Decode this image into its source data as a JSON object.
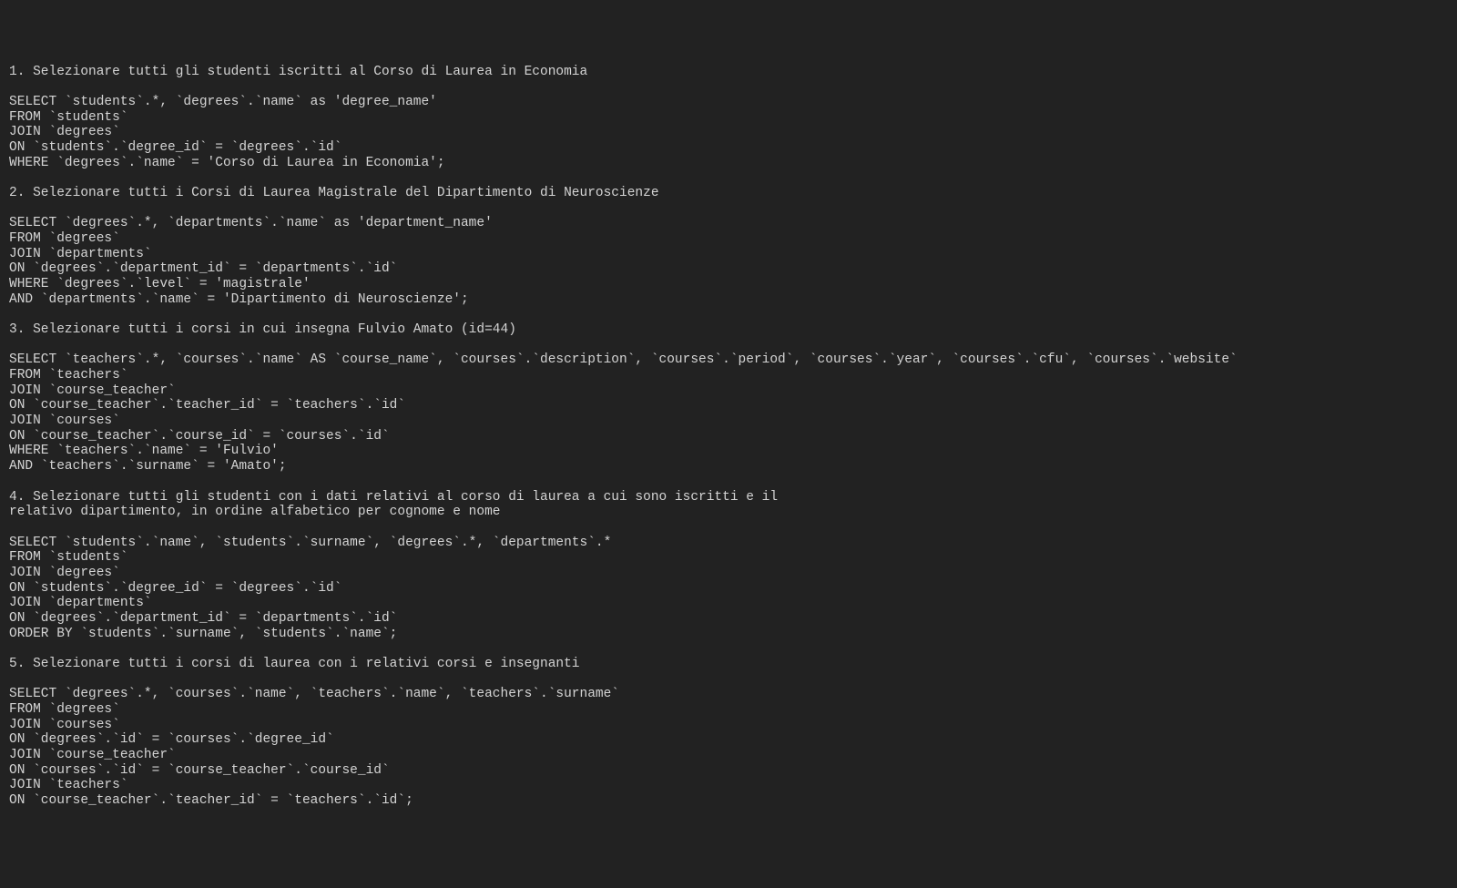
{
  "code": "1. Selezionare tutti gli studenti iscritti al Corso di Laurea in Economia\n\nSELECT `students`.*, `degrees`.`name` as 'degree_name'\nFROM `students`\nJOIN `degrees`\nON `students`.`degree_id` = `degrees`.`id`\nWHERE `degrees`.`name` = 'Corso di Laurea in Economia';\n\n2. Selezionare tutti i Corsi di Laurea Magistrale del Dipartimento di Neuroscienze\n\nSELECT `degrees`.*, `departments`.`name` as 'department_name'\nFROM `degrees`\nJOIN `departments`\nON `degrees`.`department_id` = `departments`.`id`\nWHERE `degrees`.`level` = 'magistrale'\nAND `departments`.`name` = 'Dipartimento di Neuroscienze';\n\n3. Selezionare tutti i corsi in cui insegna Fulvio Amato (id=44)\n\nSELECT `teachers`.*, `courses`.`name` AS `course_name`, `courses`.`description`, `courses`.`period`, `courses`.`year`, `courses`.`cfu`, `courses`.`website`\nFROM `teachers`\nJOIN `course_teacher`\nON `course_teacher`.`teacher_id` = `teachers`.`id`\nJOIN `courses`\nON `course_teacher`.`course_id` = `courses`.`id`\nWHERE `teachers`.`name` = 'Fulvio'\nAND `teachers`.`surname` = 'Amato';\n\n4. Selezionare tutti gli studenti con i dati relativi al corso di laurea a cui sono iscritti e il\nrelativo dipartimento, in ordine alfabetico per cognome e nome\n\nSELECT `students`.`name`, `students`.`surname`, `degrees`.*, `departments`.*\nFROM `students`\nJOIN `degrees`\nON `students`.`degree_id` = `degrees`.`id`\nJOIN `departments`\nON `degrees`.`department_id` = `departments`.`id`\nORDER BY `students`.`surname`, `students`.`name`;\n\n5. Selezionare tutti i corsi di laurea con i relativi corsi e insegnanti\n\nSELECT `degrees`.*, `courses`.`name`, `teachers`.`name`, `teachers`.`surname`\nFROM `degrees`\nJOIN `courses`\nON `degrees`.`id` = `courses`.`degree_id`\nJOIN `course_teacher`\nON `courses`.`id` = `course_teacher`.`course_id`\nJOIN `teachers`\nON `course_teacher`.`teacher_id` = `teachers`.`id`;"
}
